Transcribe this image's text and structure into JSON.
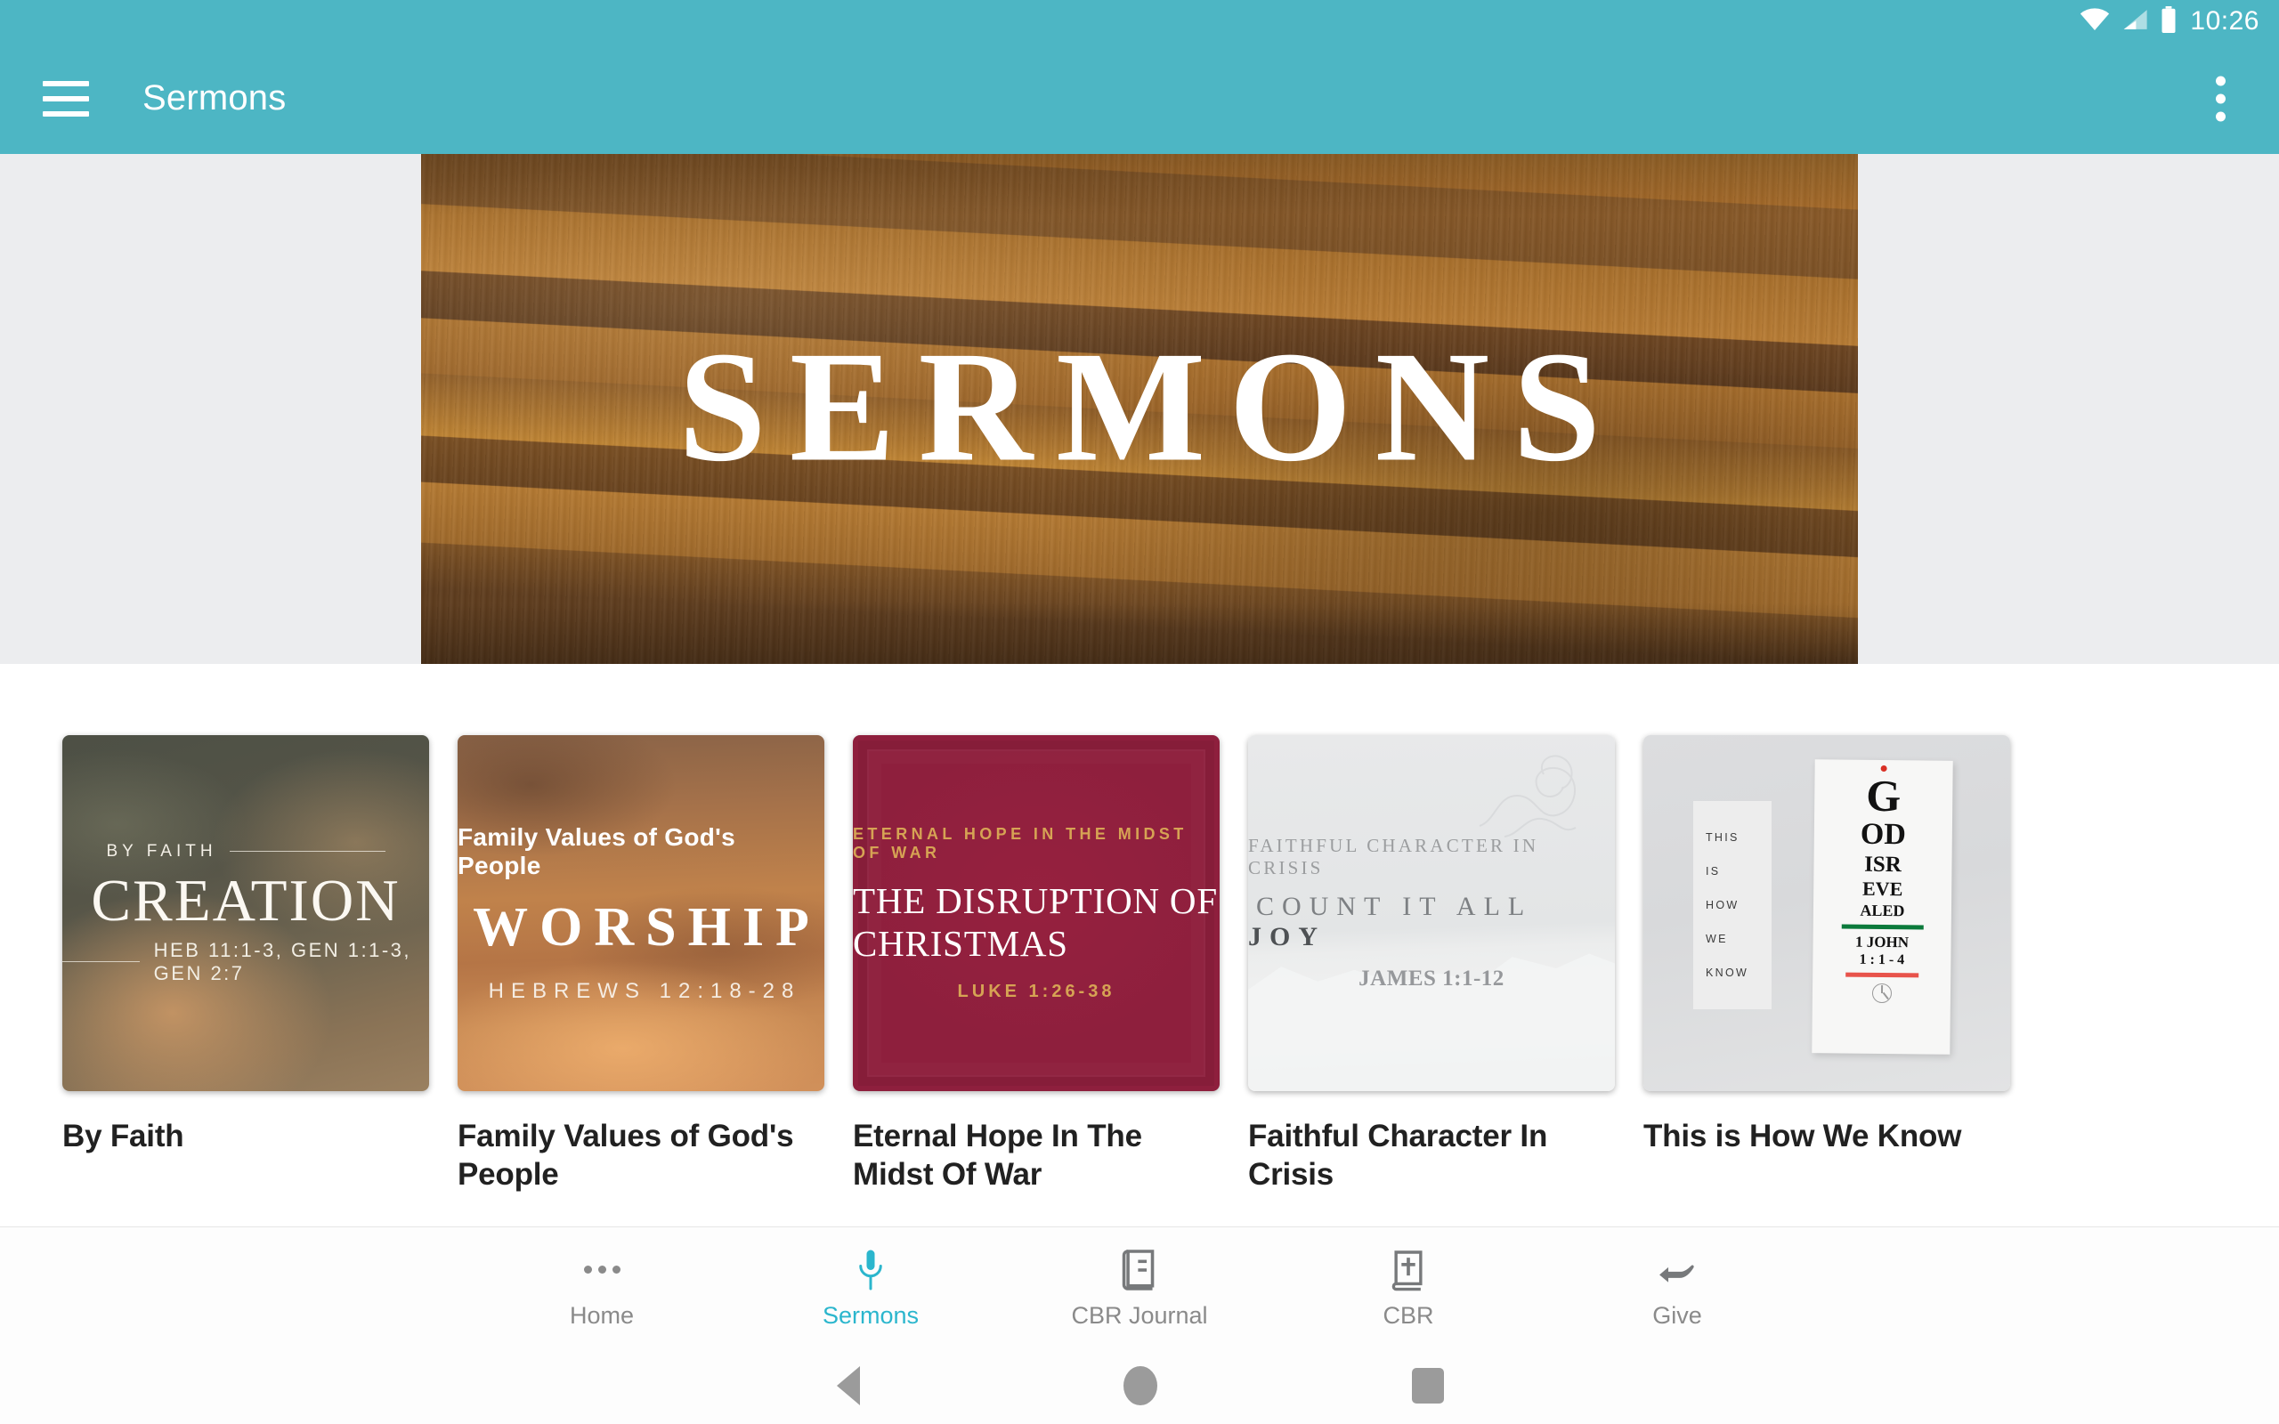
{
  "status_bar": {
    "time": "10:26",
    "icons": [
      "wifi-icon",
      "cell-signal-icon",
      "battery-icon"
    ]
  },
  "app_bar": {
    "menu_icon": "hamburger-menu-icon",
    "title": "Sermons",
    "overflow_icon": "overflow-menu-icon",
    "background_color": "#4DB6C4"
  },
  "hero": {
    "text": "SERMONS",
    "background": "wood-plank-texture"
  },
  "sermons": [
    {
      "title": "By Faith",
      "art": {
        "eyebrow": "BY FAITH",
        "headline": "CREATION",
        "reference": "HEB 11:1-3, GEN 1:1-3, GEN 2:7",
        "style": "olive-clouds"
      }
    },
    {
      "title": "Family Values of God's People",
      "art": {
        "eyebrow": "Family Values of God's People",
        "headline": "WORSHIP",
        "reference": "HEBREWS 12:18-28",
        "style": "orange-sunset-clouds"
      }
    },
    {
      "title": "Eternal Hope In The Midst Of War",
      "art": {
        "eyebrow": "ETERNAL HOPE IN THE MIDST OF WAR",
        "headline": "THE DISRUPTION OF CHRISTMAS",
        "reference": "LUKE 1:26-38",
        "style": "crimson"
      }
    },
    {
      "title": "Faithful Character In Crisis",
      "art": {
        "eyebrow": "FAITHFUL CHARACTER IN CRISIS",
        "headline_plain": "COUNT IT ALL ",
        "headline_bold": "JOY",
        "reference": "JAMES 1:1-12",
        "style": "white-paper-texture"
      }
    },
    {
      "title": "This is How We Know",
      "art": {
        "left_panel_lines": [
          "THIS",
          "IS",
          "HOW",
          "WE",
          "KNOW"
        ],
        "chart_rows": [
          "G",
          "OD",
          "ISR",
          "EVE",
          "ALED"
        ],
        "reference_line_1": "1 JOHN",
        "reference_line_2": "1 : 1 - 4",
        "green_bar_color": "#0b7a3b",
        "red_bar_color": "#e8534b",
        "style": "eye-chart-poster"
      }
    }
  ],
  "bottom_nav": {
    "active_color": "#2bb6cd",
    "inactive_color": "#8a8a8a",
    "items": [
      {
        "label": "Home",
        "icon": "more-horizontal-icon",
        "active": false
      },
      {
        "label": "Sermons",
        "icon": "microphone-icon",
        "active": true
      },
      {
        "label": "CBR Journal",
        "icon": "journal-book-icon",
        "active": false
      },
      {
        "label": "CBR",
        "icon": "bible-cross-icon",
        "active": false
      },
      {
        "label": "Give",
        "icon": "open-hand-icon",
        "active": false
      }
    ]
  },
  "system_nav": {
    "back": "back-triangle-icon",
    "home": "home-circle-icon",
    "recents": "recents-square-icon"
  }
}
